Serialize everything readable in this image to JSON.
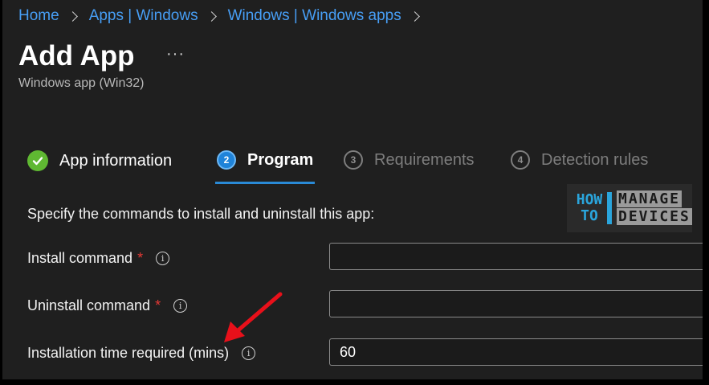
{
  "breadcrumb": {
    "items": [
      "Home",
      "Apps | Windows",
      "Windows | Windows apps"
    ]
  },
  "header": {
    "title": "Add App",
    "more": "···",
    "subtitle": "Windows app (Win32)"
  },
  "wizard": {
    "steps": [
      {
        "number": "1",
        "label": "App information",
        "state": "completed"
      },
      {
        "number": "2",
        "label": "Program",
        "state": "active"
      },
      {
        "number": "3",
        "label": "Requirements",
        "state": "pending"
      },
      {
        "number": "4",
        "label": "Detection rules",
        "state": "pending"
      }
    ]
  },
  "form": {
    "instructions": "Specify the commands to install and uninstall this app:",
    "fields": [
      {
        "label": "Install command",
        "required": "*",
        "value": ""
      },
      {
        "label": "Uninstall command",
        "required": "*",
        "value": ""
      },
      {
        "label": "Installation time required (mins)",
        "required": "",
        "value": "60"
      }
    ]
  },
  "watermark": {
    "line1": "HOW",
    "line2": "TO",
    "line3": "MANAGE",
    "line4": "DEVICES"
  },
  "colors": {
    "accent": "#479ef5",
    "success": "#5fb832",
    "active_step": "#1f83d9",
    "required": "#e53935",
    "annotation_arrow": "#e8101a"
  }
}
